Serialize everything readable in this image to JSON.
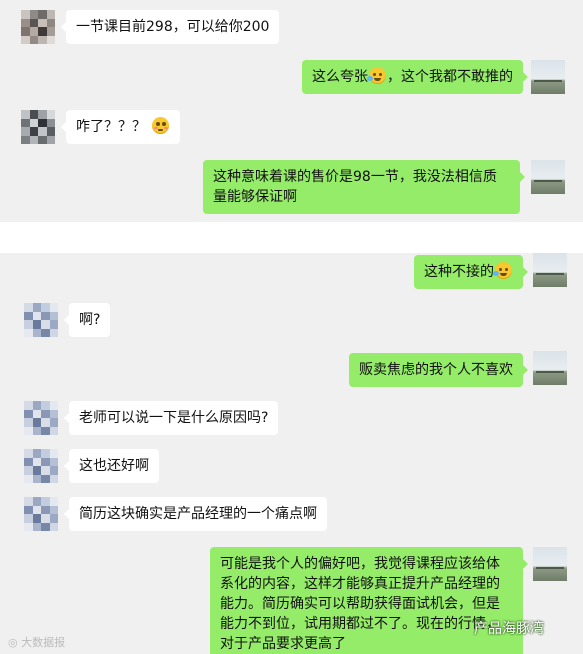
{
  "chat": {
    "messages": [
      {
        "side": "left",
        "avatar": "pixelated-avatar-a",
        "text": "一节课目前298，可以给你200"
      },
      {
        "side": "right",
        "avatar": "landscape-avatar",
        "text_before": "这么夸张",
        "emoji": "laugh-cry-emoji",
        "text_after": "，这个我都不敢推的"
      },
      {
        "side": "left",
        "avatar": "pixelated-avatar-b",
        "text_before": "咋了？？？",
        "emoji": "flushed-emoji",
        "text_after": ""
      },
      {
        "side": "right",
        "avatar": "landscape-avatar",
        "text": "这种意味着课的售价是98一节，我没法相信质量能够保证啊"
      },
      {
        "side": "right",
        "avatar": "landscape-avatar",
        "text_before": "这种不接的",
        "emoji": "laugh-cry-emoji",
        "text_after": ""
      },
      {
        "side": "left",
        "avatar": "pixelated-avatar-c",
        "text": "啊?"
      },
      {
        "side": "right",
        "avatar": "landscape-avatar",
        "text": "贩卖焦虑的我个人不喜欢"
      },
      {
        "side": "left",
        "avatar": "pixelated-avatar-c",
        "text": "老师可以说一下是什么原因吗?"
      },
      {
        "side": "left",
        "avatar": "pixelated-avatar-c",
        "text": "这也还好啊"
      },
      {
        "side": "left",
        "avatar": "pixelated-avatar-c",
        "text": "简历这块确实是产品经理的一个痛点啊"
      },
      {
        "side": "right",
        "avatar": "landscape-avatar",
        "text": "可能是我个人的偏好吧，我觉得课程应该给体系化的内容，这样才能够真正提升产品经理的能力。简历确实可以帮助获得面试机会，但是能力不到位，试用期都过不了。现在的行情，对于产品要求更高了"
      }
    ]
  },
  "watermarks": {
    "left": "大数据报",
    "right": "产品海豚湾"
  },
  "colors": {
    "chat_background": "#f0f0f0",
    "incoming_bubble": "#ffffff",
    "outgoing_bubble": "#95ec69"
  }
}
